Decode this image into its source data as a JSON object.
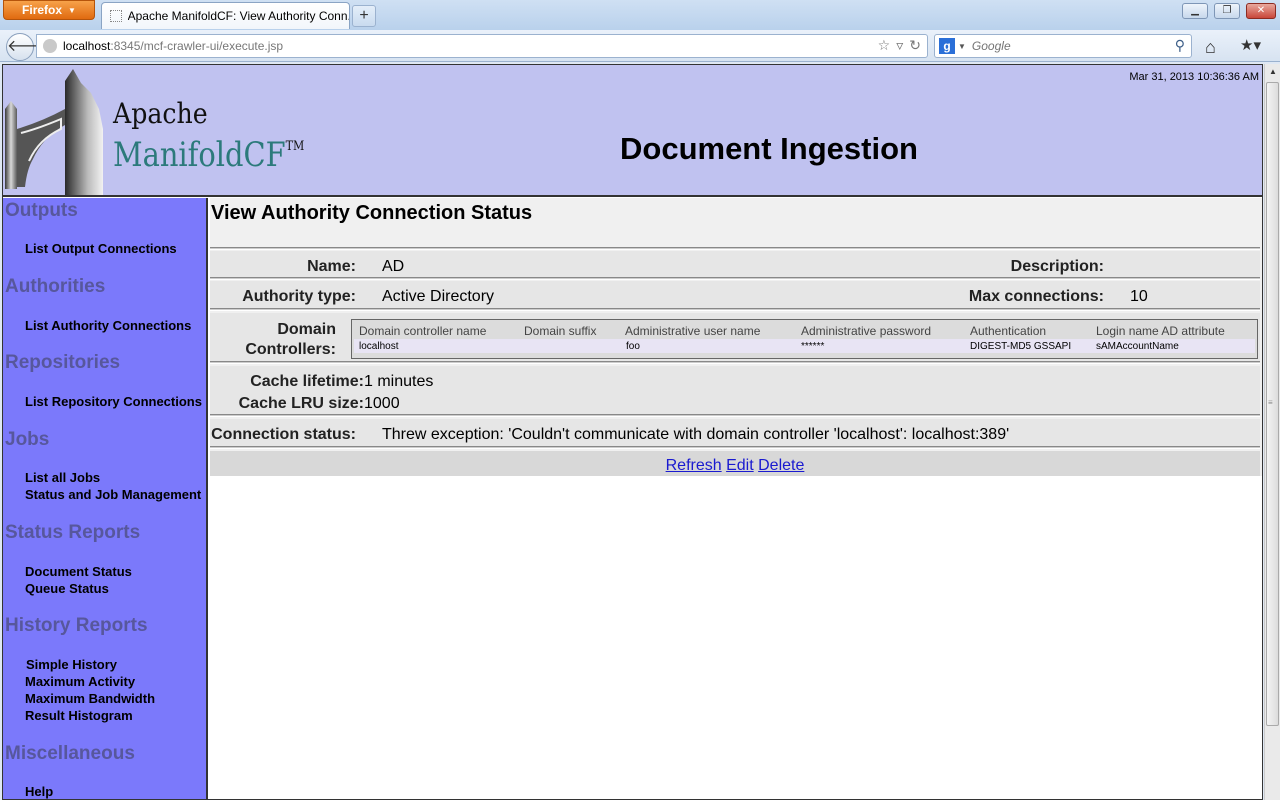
{
  "browser": {
    "app_button": "Firefox",
    "tab_title": "Apache ManifoldCF: View Authority Conn...",
    "new_tab": "+",
    "url_host": "localhost",
    "url_path": ":8345/mcf-crawler-ui/execute.jsp",
    "search_engine": "g",
    "search_placeholder": "Google"
  },
  "banner": {
    "logo_apache": "Apache",
    "logo_product": "ManifoldCF",
    "logo_tm": "TM",
    "title": "Document Ingestion",
    "datetime": "Mar 31, 2013 10:36:36 AM"
  },
  "sidebar": {
    "sections": [
      {
        "title": "Outputs",
        "items": [
          "List Output Connections"
        ]
      },
      {
        "title": "Authorities",
        "items": [
          "List Authority Connections"
        ]
      },
      {
        "title": "Repositories",
        "items": [
          "List Repository Connections"
        ]
      },
      {
        "title": "Jobs",
        "items": [
          "List all Jobs",
          "Status and Job Management"
        ]
      },
      {
        "title": "Status Reports",
        "items": [
          "Document Status",
          "Queue Status"
        ]
      },
      {
        "title": "History Reports",
        "items": [
          "Simple History",
          "Maximum Activity",
          "Maximum Bandwidth",
          "Result Histogram"
        ]
      },
      {
        "title": "Miscellaneous",
        "items": [
          "Help"
        ]
      }
    ]
  },
  "main": {
    "heading": "View Authority Connection Status",
    "name_label": "Name:",
    "name_value": "AD",
    "description_label": "Description:",
    "description_value": "",
    "type_label": "Authority type:",
    "type_value": "Active Directory",
    "maxconn_label": "Max connections:",
    "maxconn_value": "10",
    "dc_label": "Domain Controllers:",
    "dc_label_line1": "Domain",
    "dc_label_line2": "Controllers:",
    "dc_table": {
      "headers": [
        "Domain controller name",
        "Domain suffix",
        "Administrative user name",
        "Administrative password",
        "Authentication",
        "Login name AD attribute"
      ],
      "rows": [
        [
          "localhost",
          "",
          "foo",
          "******",
          "DIGEST-MD5 GSSAPI",
          "sAMAccountName"
        ]
      ]
    },
    "cache_lifetime_label": "Cache lifetime:",
    "cache_lifetime_value": "1 minutes",
    "cache_lru_label": "Cache LRU size:",
    "cache_lru_value": "1000",
    "status_label": "Connection status:",
    "status_value": "Threw exception: 'Couldn't communicate with domain controller 'localhost': localhost:389'",
    "actions": [
      "Refresh",
      "Edit",
      "Delete"
    ]
  },
  "colors": {
    "banner_bg": "#c0c2f0",
    "sidebar_bg": "#7b79fb",
    "section_text": "#57579c",
    "link": "#1a1ad0"
  }
}
